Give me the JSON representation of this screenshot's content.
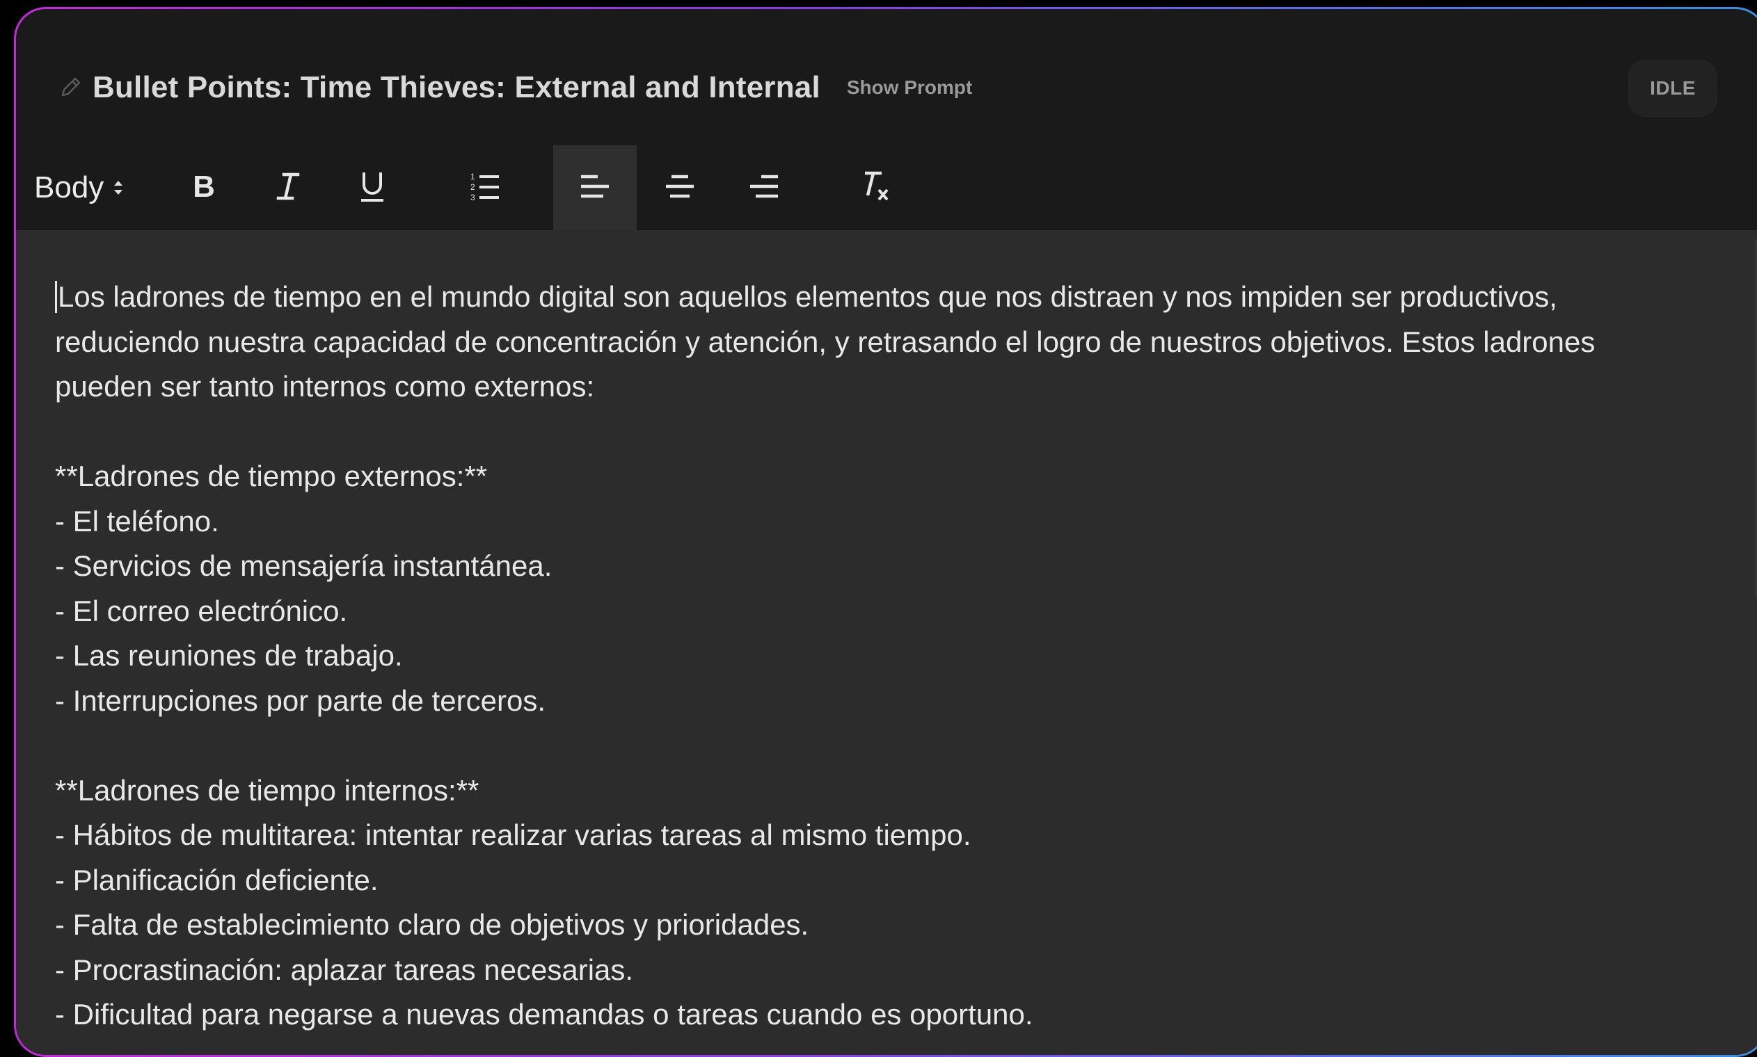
{
  "header": {
    "title": "Bullet Points: Time Thieves: External and Internal",
    "show_prompt_label": "Show Prompt",
    "status": "IDLE",
    "title_icon": "pencil-icon"
  },
  "toolbar": {
    "text_style": "Body",
    "buttons": [
      {
        "name": "bold",
        "icon": "bold-icon",
        "glyph": "B"
      },
      {
        "name": "italic",
        "icon": "italic-icon",
        "glyph": "I"
      },
      {
        "name": "underline",
        "icon": "underline-icon",
        "glyph": "U"
      },
      {
        "name": "ordered-list",
        "icon": "ordered-list-icon"
      },
      {
        "name": "align-left",
        "icon": "align-left-icon",
        "active": true
      },
      {
        "name": "align-center",
        "icon": "align-center-icon"
      },
      {
        "name": "align-right",
        "icon": "align-right-icon"
      },
      {
        "name": "clear-format",
        "icon": "clear-format-icon",
        "glyph": "Tx"
      }
    ]
  },
  "editor": {
    "paragraphs": [
      "Los ladrones de tiempo en el mundo digital son aquellos elementos que nos distraen y nos impiden ser productivos, reduciendo nuestra capacidad de concentración y atención, y retrasando el logro de nuestros objetivos. Estos ladrones pueden ser tanto internos como externos:",
      "",
      "**Ladrones de tiempo externos:**",
      "- El teléfono.",
      "- Servicios de mensajería instantánea.",
      "- El correo electrónico.",
      "- Las reuniones de trabajo.",
      "- Interrupciones por parte de terceros.",
      "",
      "**Ladrones de tiempo internos:**",
      "- Hábitos de multitarea: intentar realizar varias tareas al mismo tiempo.",
      "- Planificación deficiente.",
      "- Falta de establecimiento claro de objetivos y prioridades.",
      "- Procrastinación: aplazar tareas necesarias.",
      "- Dificultad para negarse a nuevas demandas o tareas cuando es oportuno."
    ]
  },
  "colors": {
    "background": "#1a1a1a",
    "editor_background": "#2c2c2c",
    "text": "#e8e8e8",
    "border_gradient_start": "#c02bd6",
    "border_gradient_end": "#3a8fe0"
  }
}
